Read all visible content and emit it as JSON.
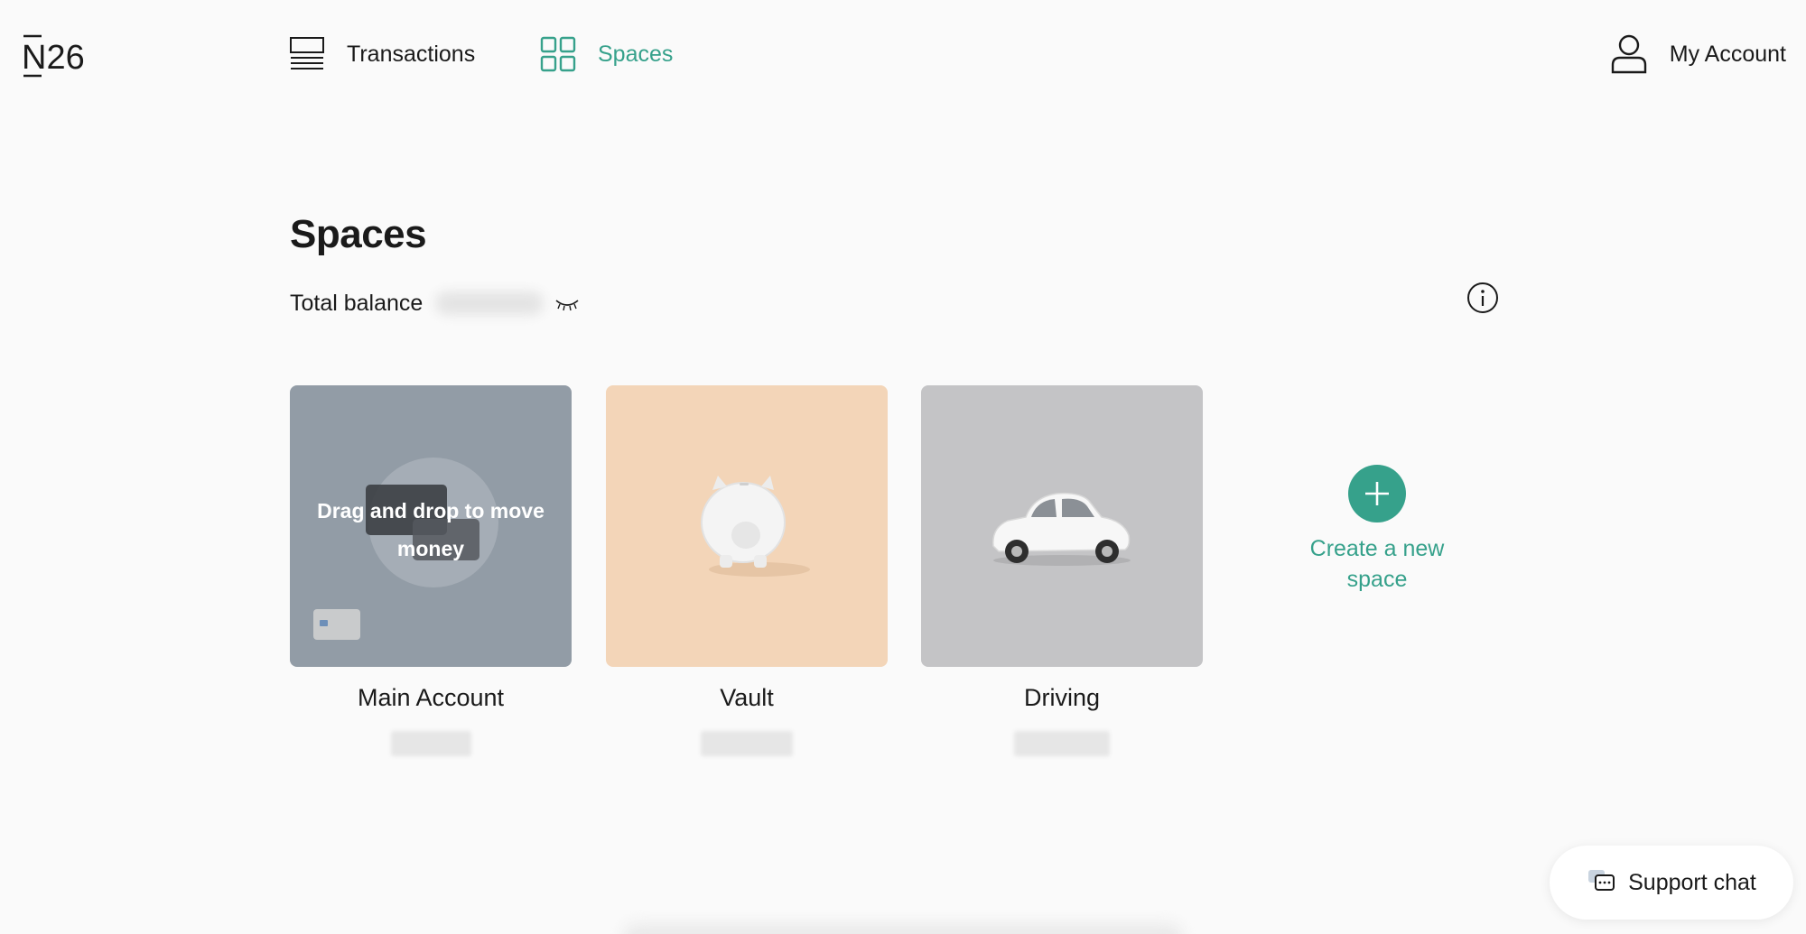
{
  "brand": {
    "logo_text": "N26"
  },
  "nav": {
    "transactions": {
      "label": "Transactions",
      "icon": "list-icon"
    },
    "spaces": {
      "label": "Spaces",
      "icon": "grid-icon",
      "active": true
    },
    "account": {
      "label": "My Account",
      "icon": "user-icon"
    }
  },
  "page": {
    "title": "Spaces",
    "balance_label": "Total balance",
    "balance_hidden": true
  },
  "spaces": [
    {
      "name": "Main Account",
      "overlay_text": "Drag and drop to move money",
      "color": "#929ca6"
    },
    {
      "name": "Vault",
      "color": "#f3d5b8"
    },
    {
      "name": "Driving",
      "color": "#c4c4c6"
    }
  ],
  "create_space": {
    "label": "Create a new space",
    "icon": "plus-icon"
  },
  "support": {
    "label": "Support chat",
    "icon": "chat-icon"
  },
  "colors": {
    "accent": "#36a18b",
    "background": "#fafafa",
    "text": "#1a1a1a"
  }
}
